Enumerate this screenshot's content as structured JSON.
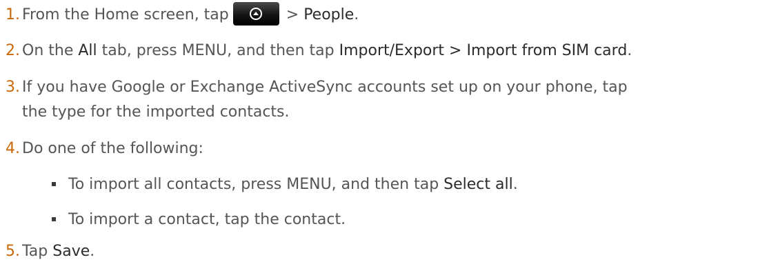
{
  "steps": [
    {
      "number": "1.",
      "parts": [
        "From the Home screen, tap",
        "> ",
        "People",
        "."
      ]
    },
    {
      "number": "2.",
      "parts": [
        "On the ",
        "All",
        " tab, press MENU, and then tap ",
        "Import/Export > Import from SIM card",
        "."
      ]
    },
    {
      "number": "3.",
      "line1": "If you have Google or Exchange ActiveSync accounts set up on your phone, tap",
      "line2": "the type for the imported contacts."
    },
    {
      "number": "4.",
      "text": "Do one of the following:",
      "bullets": [
        {
          "parts": [
            "To import all contacts, press MENU, and then tap ",
            "Select all",
            "."
          ]
        },
        {
          "parts": [
            "To import a contact, tap the contact."
          ]
        }
      ]
    },
    {
      "number": "5.",
      "parts": [
        "Tap ",
        "Save",
        "."
      ]
    }
  ],
  "icons": {
    "home_button": "all-apps-arrow-up-icon"
  },
  "colors": {
    "step_number": "#c9690a",
    "body_text": "#555555",
    "highlight_text": "#2b2b2b"
  }
}
